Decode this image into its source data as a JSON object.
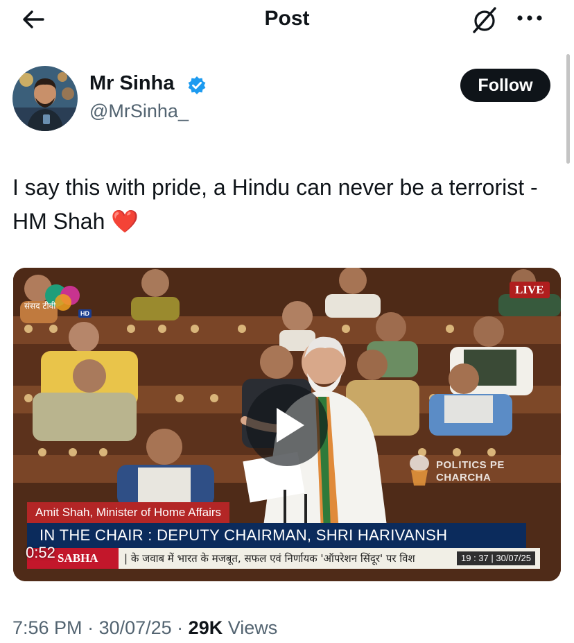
{
  "header": {
    "title": "Post"
  },
  "author": {
    "display_name": "Mr Sinha",
    "handle": "@MrSinha_",
    "follow_label": "Follow"
  },
  "post": {
    "text": "I say this with pride, a Hindu can never be a terrorist - HM Shah",
    "emoji": "❤️"
  },
  "video": {
    "channel_logo_text": "संसद टीवी",
    "hd_label": "HD",
    "live_label": "LIVE",
    "watermark_line1": "POLITICS PE",
    "watermark_line2": "CHARCHA",
    "name_strip": "Amit Shah, Minister of Home Affairs",
    "chair_strip": "IN THE CHAIR : DEPUTY CHAIRMAN, SHRI HARIVANSH",
    "ticker_channel": "SABHA",
    "ticker_text": "| के जवाब में भारत के मजबूत, सफल एवं निर्णायक 'ऑपरेशन सिंदूर' पर विश",
    "ticker_time": "19 : 37 | 30/07/25",
    "duration": "0:52"
  },
  "meta": {
    "time": "7:56 PM",
    "date": "30/07/25",
    "separator": " · ",
    "views_count": "29K",
    "views_label": " Views"
  },
  "colors": {
    "text_primary": "#0f1419",
    "text_secondary": "#536471",
    "verified_blue": "#1d9bf0",
    "follow_bg": "#0f1419"
  },
  "icons": [
    "back-arrow-icon",
    "grok-icon",
    "more-icon",
    "verified-badge-icon",
    "play-icon"
  ]
}
